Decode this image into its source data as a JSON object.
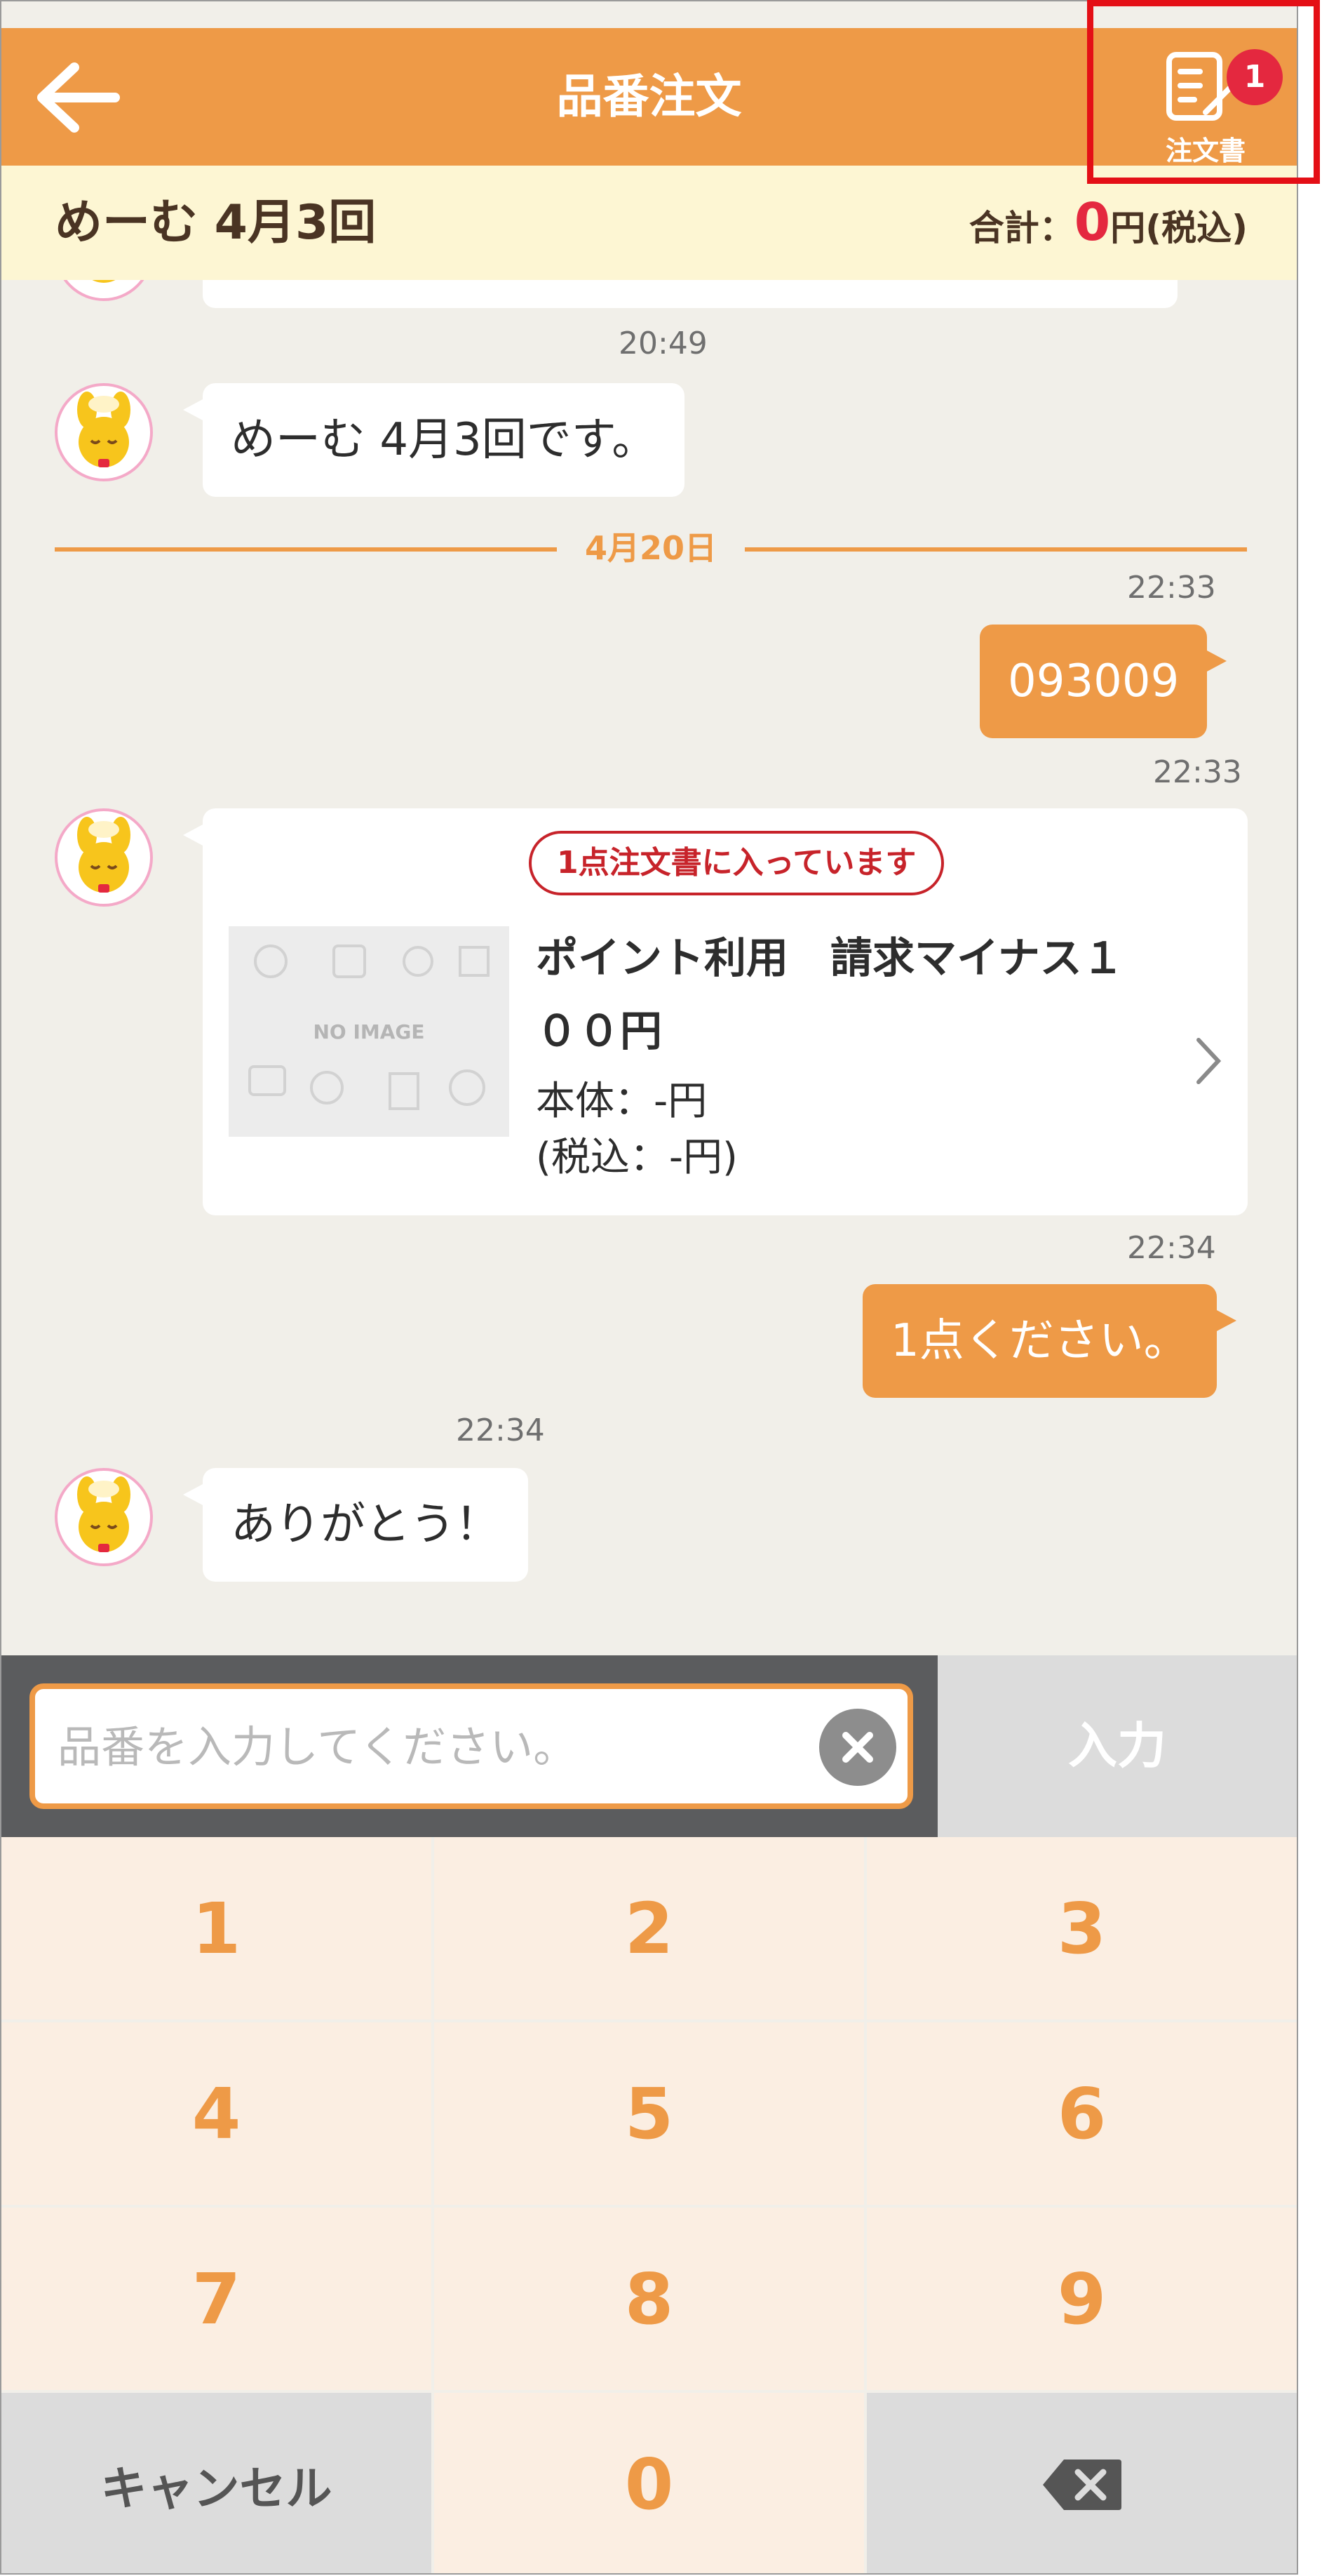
{
  "header": {
    "title": "品番注文",
    "order_doc_label": "注文書",
    "order_badge": "1"
  },
  "subheader": {
    "session": "めーむ 4月3回",
    "total_label": "合計：",
    "total_amount": "0",
    "total_unit": "円(税込)"
  },
  "chat": {
    "time_1": "20:49",
    "msg_1": "めーむ 4月3回です。",
    "date_sep": "4月20日",
    "time_2": "22:33",
    "msg_2": "093009",
    "time_3": "22:33",
    "card": {
      "in_cart": "1点注文書に入っています",
      "no_image": "NO IMAGE",
      "name_line1": "ポイント利用　請求マイナス１",
      "name_line2": "００円",
      "price": "本体：-円",
      "price_tax": "(税込：-円)"
    },
    "time_4": "22:34",
    "msg_3": "1点ください。",
    "time_5": "22:34",
    "msg_4": "ありがとう！"
  },
  "input": {
    "placeholder": "品番を入力してください。",
    "value": "",
    "enter_label": "入力"
  },
  "keypad": {
    "k1": "1",
    "k2": "2",
    "k3": "3",
    "k4": "4",
    "k5": "5",
    "k6": "6",
    "k7": "7",
    "k8": "8",
    "k9": "9",
    "cancel": "キャンセル",
    "k0": "0"
  },
  "colors": {
    "accent": "#ee9a47",
    "badge": "#e4283f",
    "chat_bg": "#f1efe9",
    "highlight": "#e40f16"
  }
}
